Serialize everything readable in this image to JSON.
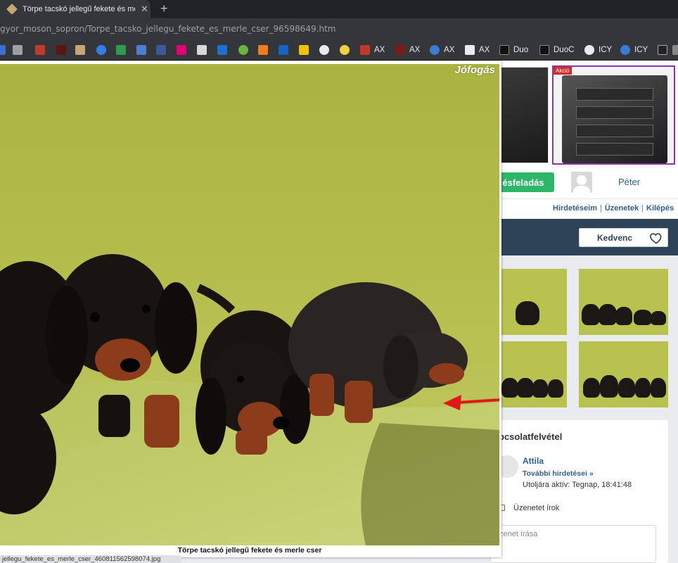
{
  "browser": {
    "tab_title": "Törpe tacskó jellegű fekete és mer",
    "url": "gyor_moson_sopron/Torpe_tacsko_jellegu_fekete_es_merle_cser_96598649.htm",
    "bookmark_labels": [
      "AX",
      "AX",
      "AX",
      "AX",
      "Duo",
      "DuoC",
      "ICY",
      "ICY"
    ]
  },
  "site": {
    "ad_badge": "Akció",
    "post_button": "ésfeladás",
    "user_name": "Péter",
    "user_nav": {
      "items": [
        "Hirdetéseim",
        "Üzenetek",
        "Kilépés"
      ],
      "separator": "|"
    },
    "favorite_label": "Kedvenc"
  },
  "contact": {
    "title": "pcsolatfelvétel",
    "seller_name": "Attila",
    "more_ads": "További hirdetései »",
    "last_active": "Utoljára aktív: Tegnap, 18:41:48",
    "message_label": "Üzenetet írok",
    "message_placeholder": "zenet írása"
  },
  "lightbox": {
    "watermark": "Jófogás",
    "caption": "Törpe tacskó jellegű fekete és merle cser",
    "status_url": "jellegu_fekete_es_merle_cser_460811562598074.jpg"
  },
  "colors": {
    "post_button": "#2bb66a",
    "navy_bar": "#2f4358",
    "link": "#2f5f8f",
    "ad_border": "#8a35a8",
    "photo_bg": "#aeb845",
    "arrow": "#e01818"
  }
}
